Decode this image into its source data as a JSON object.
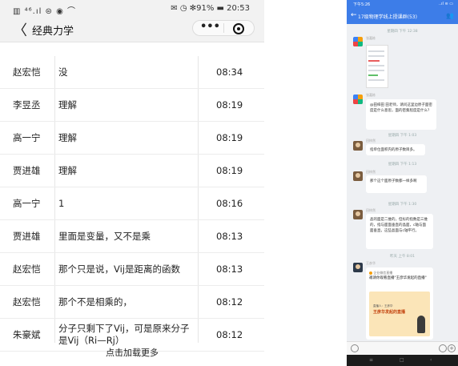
{
  "left": {
    "status": {
      "left": "▥ ⁴⁶.ıl ⊜ ◉ ⌒",
      "right": "✉ ◷ ✻91% ▬ 20:53"
    },
    "nav": {
      "back": "〈",
      "title": "经典力学",
      "more": "•••"
    },
    "rows": [
      {
        "name": "赵宏恺",
        "msg": "没",
        "time": "08:34"
      },
      {
        "name": "李昱丞",
        "msg": "理解",
        "time": "08:19"
      },
      {
        "name": "高一宁",
        "msg": "理解",
        "time": "08:19"
      },
      {
        "name": "贾进雄",
        "msg": "理解",
        "time": "08:19"
      },
      {
        "name": "高一宁",
        "msg": "1",
        "time": "08:16"
      },
      {
        "name": "贾进雄",
        "msg": "里面是变量，又不是乘",
        "time": "08:13"
      },
      {
        "name": "赵宏恺",
        "msg": "那个只是说，Vij是距离的函数",
        "time": "08:13"
      },
      {
        "name": "赵宏恺",
        "msg": "那个不是相乘的，",
        "time": "08:12"
      },
      {
        "name": "朱豪斌",
        "msg": "分子只剩下了Vij，可是原来分子是Vij（Ri—Rj）",
        "time": "08:12"
      }
    ],
    "load_more": "点击加载更多"
  },
  "right": {
    "status": {
      "left": "下午5:26",
      "right": "..ıl ≋ ▭"
    },
    "header": {
      "back": "←",
      "title": "17级物理学线上授课群(53)",
      "people": "👥"
    },
    "timestamps": [
      "星期四 下午 12:38",
      "星期四 下午 1:03",
      "星期四 下午 1:13",
      "星期四 下午 1:30",
      "昨天 上午 8:01"
    ],
    "senders": [
      "张嘉栋",
      "张嘉栋",
      "田梓然",
      "田梓然",
      "田梓然",
      "王彦华"
    ],
    "messages": [
      "@田梓田 田老师，请问这里边原子面密度是什么意思，面的密集程度是什么？",
      "指单位面积内的原子数目多。",
      "那个这个面原子数都一样多啊",
      "晶的面是二维的，但标的指数是三维的，指与面面垂直的晶面，c轴与面面垂直，这些晶面与c轴平行。"
    ],
    "live_card": {
      "source": "企业微信直播",
      "heading": "邀请你观看直播\"王彦华发起的直播\"",
      "host": "直播人：王彦华",
      "title": "王彦华发起的直播"
    },
    "navbar": [
      "≡",
      "□",
      "‹"
    ]
  }
}
